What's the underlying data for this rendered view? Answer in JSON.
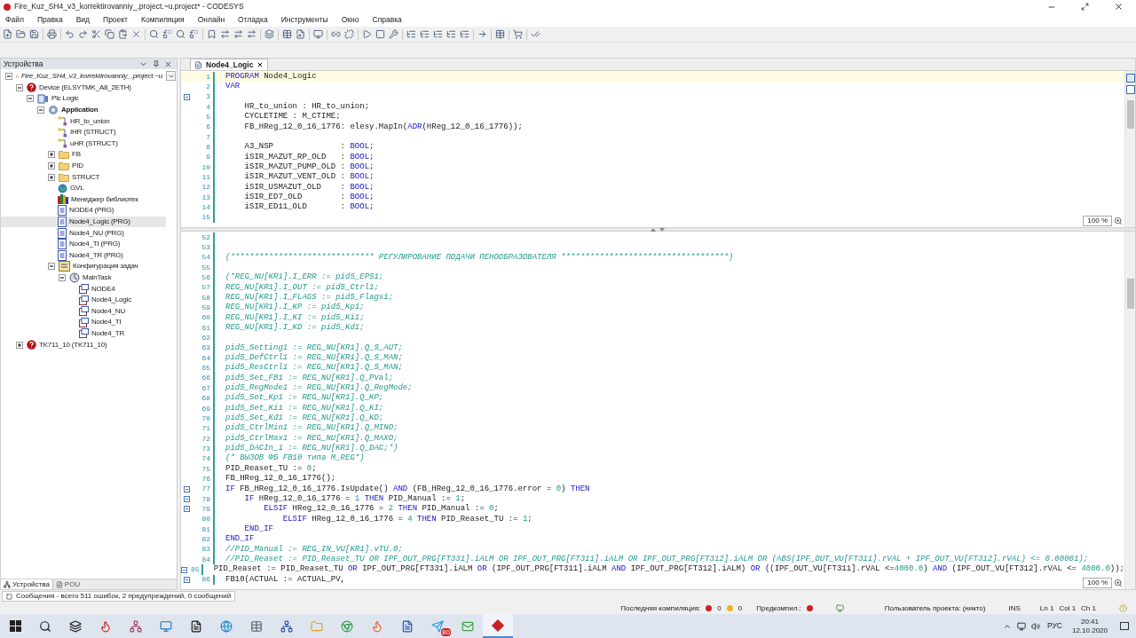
{
  "window": {
    "title": "Fire_Kuz_SH4_v3_korrektirovanniy_.project.~u.project* - CODESYS"
  },
  "menu": [
    "Файл",
    "Правка",
    "Вид",
    "Проект",
    "Компиляция",
    "Онлайн",
    "Отладка",
    "Инструменты",
    "Окно",
    "Справка"
  ],
  "devices_panel": {
    "title": "Устройства",
    "tree": [
      {
        "label": "Fire_Kuz_SH4_v3_korrektirovanniy_.project.~u",
        "kind": "project",
        "expanded": true,
        "selected": false,
        "children": [
          {
            "label": "Device (ELSYTMK_A8_2ETH)",
            "kind": "error",
            "expanded": true,
            "selected": false,
            "children": [
              {
                "label": "Plc Logic",
                "kind": "plc",
                "expanded": true,
                "selected": false,
                "children": [
                  {
                    "label": "Application",
                    "kind": "gear",
                    "expanded": true,
                    "selected": false,
                    "children": [
                      {
                        "label": "HR_to_union",
                        "kind": "struct",
                        "selected": false
                      },
                      {
                        "label": "IHR (STRUCT)",
                        "kind": "struct",
                        "selected": false
                      },
                      {
                        "label": "uHR (STRUCT)",
                        "kind": "struct",
                        "selected": false
                      },
                      {
                        "label": "FB",
                        "kind": "folder",
                        "expanded": false,
                        "selected": false
                      },
                      {
                        "label": "PID",
                        "kind": "folder",
                        "expanded": false,
                        "selected": false
                      },
                      {
                        "label": "STRUCT",
                        "kind": "folder",
                        "expanded": false,
                        "selected": false
                      },
                      {
                        "label": "GVL",
                        "kind": "globe",
                        "selected": false
                      },
                      {
                        "label": "Менеджер библиотек",
                        "kind": "library",
                        "selected": false
                      },
                      {
                        "label": "NODE4 (PRG)",
                        "kind": "prg",
                        "selected": false
                      },
                      {
                        "label": "Node4_Logic (PRG)",
                        "kind": "prg",
                        "selected": true
                      },
                      {
                        "label": "Node4_NU (PRG)",
                        "kind": "prg",
                        "selected": false
                      },
                      {
                        "label": "Node4_TI (PRG)",
                        "kind": "prg",
                        "selected": false
                      },
                      {
                        "label": "Node4_TR (PRG)",
                        "kind": "prg",
                        "selected": false
                      },
                      {
                        "label": "Конфигурация задач",
                        "kind": "taskconfig",
                        "expanded": true,
                        "selected": false,
                        "children": [
                          {
                            "label": "MainTask",
                            "kind": "task",
                            "expanded": true,
                            "selected": false,
                            "children": [
                              {
                                "label": "NODE4",
                                "kind": "call",
                                "selected": false
                              },
                              {
                                "label": "Node4_Logic",
                                "kind": "call",
                                "selected": false
                              },
                              {
                                "label": "Node4_NU",
                                "kind": "call",
                                "selected": false
                              },
                              {
                                "label": "Node4_TI",
                                "kind": "call",
                                "selected": false
                              },
                              {
                                "label": "Node4_TR",
                                "kind": "call",
                                "selected": false
                              }
                            ]
                          }
                        ]
                      }
                    ]
                  }
                ]
              }
            ]
          },
          {
            "label": "TK711_10 (TK711_10)",
            "kind": "error",
            "expanded": false,
            "selected": false
          }
        ]
      }
    ]
  },
  "bottom_tabs": [
    {
      "label": "Устройства",
      "selected": true
    },
    {
      "label": "POU",
      "selected": false
    }
  ],
  "editor": {
    "tab": "Node4_Logic",
    "top_pane": {
      "zoom": "100 %",
      "lines": [
        {
          "num": "1",
          "fold": false,
          "current": true,
          "tokens": [
            {
              "kind": "kw",
              "text": "PROGRAM"
            },
            {
              "kind": "plain",
              "text": " Node4_Logic"
            }
          ]
        },
        {
          "num": "2",
          "fold": false,
          "current": false,
          "tokens": [
            {
              "kind": "kw",
              "text": "VAR"
            }
          ]
        },
        {
          "num": "3",
          "fold": true,
          "current": false
        },
        {
          "num": "4",
          "fold": false,
          "current": false,
          "tokens": [
            {
              "kind": "plain",
              "text": "    HR_to_union : HR_to_union;"
            }
          ]
        },
        {
          "num": "5",
          "fold": false,
          "current": false,
          "tokens": [
            {
              "kind": "plain",
              "text": "    CYCLETIME : M_CTIME;"
            }
          ]
        },
        {
          "num": "6",
          "fold": false,
          "current": false,
          "tokens": [
            {
              "kind": "plain",
              "text": "    FB_HReg_12_0_16_1776: elesy.MapIn("
            },
            {
              "kind": "kw",
              "text": "ADR"
            },
            {
              "kind": "plain",
              "text": "(HReg_12_0_16_1776));"
            }
          ]
        },
        {
          "num": "7",
          "fold": false,
          "current": false
        },
        {
          "num": "8",
          "fold": false,
          "current": false,
          "tokens": [
            {
              "kind": "plain",
              "text": "    A3_NSP              : "
            },
            {
              "kind": "kw",
              "text": "BOOL"
            },
            {
              "kind": "plain",
              "text": ";"
            }
          ]
        },
        {
          "num": "9",
          "fold": false,
          "current": false,
          "tokens": [
            {
              "kind": "plain",
              "text": "    iSIR_MAZUT_RP_OLD   : "
            },
            {
              "kind": "kw",
              "text": "BOOL"
            },
            {
              "kind": "plain",
              "text": ";"
            }
          ]
        },
        {
          "num": "10",
          "fold": false,
          "current": false,
          "tokens": [
            {
              "kind": "plain",
              "text": "    iSIR_MAZUT_PUMP_OLD : "
            },
            {
              "kind": "kw",
              "text": "BOOL"
            },
            {
              "kind": "plain",
              "text": ";"
            }
          ]
        },
        {
          "num": "11",
          "fold": false,
          "current": false,
          "tokens": [
            {
              "kind": "plain",
              "text": "    iSIR_MAZUT_VENT_OLD : "
            },
            {
              "kind": "kw",
              "text": "BOOL"
            },
            {
              "kind": "plain",
              "text": ";"
            }
          ]
        },
        {
          "num": "12",
          "fold": false,
          "current": false,
          "tokens": [
            {
              "kind": "plain",
              "text": "    iSIR_USMAZUT_OLD    : "
            },
            {
              "kind": "kw",
              "text": "BOOL"
            },
            {
              "kind": "plain",
              "text": ";"
            }
          ]
        },
        {
          "num": "13",
          "fold": false,
          "current": false,
          "tokens": [
            {
              "kind": "plain",
              "text": "    iSIR_ED7_OLD        : "
            },
            {
              "kind": "kw",
              "text": "BOOL"
            },
            {
              "kind": "plain",
              "text": ";"
            }
          ]
        },
        {
          "num": "14",
          "fold": false,
          "current": false,
          "tokens": [
            {
              "kind": "plain",
              "text": "    iSIR_ED11_OLD       : "
            },
            {
              "kind": "kw",
              "text": "BOOL"
            },
            {
              "kind": "plain",
              "text": ";"
            }
          ]
        },
        {
          "num": "15",
          "fold": false,
          "current": false
        }
      ]
    },
    "bottom_pane": {
      "zoom": "100 %",
      "lines": [
        {
          "num": "52",
          "fold": false
        },
        {
          "num": "53",
          "fold": false
        },
        {
          "num": "54",
          "fold": false,
          "tokens": [
            {
              "kind": "comment",
              "text": "(****************************** РЕГУЛИРОВАНИЕ ПОДАЧИ ПЕНООБРАЗОВАТЕЛЯ ***********************************)"
            }
          ]
        },
        {
          "num": "55",
          "fold": false
        },
        {
          "num": "56",
          "fold": false,
          "tokens": [
            {
              "kind": "comment",
              "text": "(*REG_NU[KR1].I_ERR := pid5_EPS1;"
            }
          ]
        },
        {
          "num": "57",
          "fold": false,
          "tokens": [
            {
              "kind": "comment",
              "text": "REG_NU[KR1].I_OUT := pid5_Ctrl1;"
            }
          ]
        },
        {
          "num": "58",
          "fold": false,
          "tokens": [
            {
              "kind": "comment",
              "text": "REG_NU[KR1].I_FLAGS := pid5_Flags1;"
            }
          ]
        },
        {
          "num": "59",
          "fold": false,
          "tokens": [
            {
              "kind": "comment",
              "text": "REG_NU[KR1].I_KP := pid5_Kp1;"
            }
          ]
        },
        {
          "num": "60",
          "fold": false,
          "tokens": [
            {
              "kind": "comment",
              "text": "REG_NU[KR1].I_KI := pid5_Ki1;"
            }
          ]
        },
        {
          "num": "61",
          "fold": false,
          "tokens": [
            {
              "kind": "comment",
              "text": "REG_NU[KR1].I_KD := pid5_Kd1;"
            }
          ]
        },
        {
          "num": "62",
          "fold": false
        },
        {
          "num": "63",
          "fold": false,
          "tokens": [
            {
              "kind": "comment",
              "text": "pid5_Setting1 := REG_NU[KR1].Q_S_AUT;"
            }
          ]
        },
        {
          "num": "64",
          "fold": false,
          "tokens": [
            {
              "kind": "comment",
              "text": "pid5_DefCtrl1 := REG_NU[KR1].Q_S_MAN;"
            }
          ]
        },
        {
          "num": "65",
          "fold": false,
          "tokens": [
            {
              "kind": "comment",
              "text": "pid5_ResCtrl1 := REG_NU[KR1].Q_S_MAN;"
            }
          ]
        },
        {
          "num": "66",
          "fold": false,
          "tokens": [
            {
              "kind": "comment",
              "text": "pid5_Set_FB1 := REG_NU[KR1].Q_PVal;"
            }
          ]
        },
        {
          "num": "67",
          "fold": false,
          "tokens": [
            {
              "kind": "comment",
              "text": "pid5_RegMode1 := REG_NU[KR1].Q_RegMode;"
            }
          ]
        },
        {
          "num": "68",
          "fold": false,
          "tokens": [
            {
              "kind": "comment",
              "text": "pid5_Set_Kp1 := REG_NU[KR1].Q_KP;"
            }
          ]
        },
        {
          "num": "69",
          "fold": false,
          "tokens": [
            {
              "kind": "comment",
              "text": "pid5_Set_Ki1 := REG_NU[KR1].Q_KI;"
            }
          ]
        },
        {
          "num": "70",
          "fold": false,
          "tokens": [
            {
              "kind": "comment",
              "text": "pid5_Set_Kd1 := REG_NU[KR1].Q_KD;"
            }
          ]
        },
        {
          "num": "71",
          "fold": false,
          "tokens": [
            {
              "kind": "comment",
              "text": "pid5_CtrlMin1 := REG_NU[KR1].Q_MINO;"
            }
          ]
        },
        {
          "num": "72",
          "fold": false,
          "tokens": [
            {
              "kind": "comment",
              "text": "pid5_CtrlMax1 := REG_NU[KR1].Q_MAXO;"
            }
          ]
        },
        {
          "num": "73",
          "fold": false,
          "tokens": [
            {
              "kind": "comment",
              "text": "pid5_DACIn_1 := REG_NU[KR1].Q_DAC;*)"
            }
          ]
        },
        {
          "num": "74",
          "fold": false,
          "tokens": [
            {
              "kind": "comment",
              "text": "(* ВЫЗОВ ФБ FB10 типа M_REG*)"
            }
          ]
        },
        {
          "num": "75",
          "fold": false,
          "tokens": [
            {
              "kind": "plain",
              "text": "PID_Reaset_TU := "
            },
            {
              "kind": "num",
              "text": "0"
            },
            {
              "kind": "plain",
              "text": ";"
            }
          ]
        },
        {
          "num": "76",
          "fold": false,
          "tokens": [
            {
              "kind": "plain",
              "text": "FB_HReg_12_0_16_1776();"
            }
          ]
        },
        {
          "num": "77",
          "fold": true,
          "tokens": [
            {
              "kind": "kw",
              "text": "IF"
            },
            {
              "kind": "plain",
              "text": " FB_HReg_12_0_16_1776.IsUpdate() "
            },
            {
              "kind": "kw",
              "text": "AND"
            },
            {
              "kind": "plain",
              "text": " (FB_HReg_12_0_16_1776.error = "
            },
            {
              "kind": "num",
              "text": "0"
            },
            {
              "kind": "plain",
              "text": ") "
            },
            {
              "kind": "kw",
              "text": "THEN"
            }
          ]
        },
        {
          "num": "78",
          "fold": true,
          "tokens": [
            {
              "kind": "kw",
              "text": "    IF"
            },
            {
              "kind": "plain",
              "text": " HReg_12_0_16_1776 = "
            },
            {
              "kind": "num",
              "text": "1"
            },
            {
              "kind": "kw",
              "text": " THEN"
            },
            {
              "kind": "plain",
              "text": " PID_Manual := "
            },
            {
              "kind": "num",
              "text": "1"
            },
            {
              "kind": "plain",
              "text": ";"
            }
          ]
        },
        {
          "num": "79",
          "fold": true,
          "tokens": [
            {
              "kind": "kw",
              "text": "        ELSIF"
            },
            {
              "kind": "plain",
              "text": " HReg_12_0_16_1776 = "
            },
            {
              "kind": "num",
              "text": "2"
            },
            {
              "kind": "kw",
              "text": " THEN"
            },
            {
              "kind": "plain",
              "text": " PID_Manual := "
            },
            {
              "kind": "num",
              "text": "0"
            },
            {
              "kind": "plain",
              "text": ";"
            }
          ]
        },
        {
          "num": "80",
          "fold": false,
          "tokens": [
            {
              "kind": "kw",
              "text": "            ELSIF"
            },
            {
              "kind": "plain",
              "text": " HReg_12_0_16_1776 = "
            },
            {
              "kind": "num",
              "text": "4"
            },
            {
              "kind": "kw",
              "text": " THEN"
            },
            {
              "kind": "plain",
              "text": " PID_Reaset_TU := "
            },
            {
              "kind": "num",
              "text": "1"
            },
            {
              "kind": "plain",
              "text": ";"
            }
          ]
        },
        {
          "num": "81",
          "fold": false,
          "tokens": [
            {
              "kind": "kw",
              "text": "    END_IF"
            }
          ]
        },
        {
          "num": "82",
          "fold": false,
          "tokens": [
            {
              "kind": "kw",
              "text": "END_IF"
            }
          ]
        },
        {
          "num": "83",
          "fold": false,
          "tokens": [
            {
              "kind": "comment",
              "text": "//PID_Manual := REG_IN_VU[KR1].vTU.0;"
            }
          ]
        },
        {
          "num": "84",
          "fold": false,
          "tokens": [
            {
              "kind": "comment",
              "text": "//PID_Reaset := PID_Reaset_TU OR IPF_OUT_PRG[FT331].iALM OR IPF_OUT_PRG[FT311].iALM OR IPF_OUT_PRG[FT312].iALM OR (ABS(IPF_OUT_VU[FT311].rVAL + IPF_OUT_VU[FT312].rVAL) <= 0.00001);"
            }
          ]
        },
        {
          "num": "85",
          "fold": true,
          "tokens": [
            {
              "kind": "plain",
              "text": "PID_Reaset := PID_Reaset_TU "
            },
            {
              "kind": "kw",
              "text": "OR"
            },
            {
              "kind": "plain",
              "text": " IPF_OUT_PRG[FT331].iALM "
            },
            {
              "kind": "kw",
              "text": "OR"
            },
            {
              "kind": "plain",
              "text": " (IPF_OUT_PRG[FT311].iALM "
            },
            {
              "kind": "kw",
              "text": "AND"
            },
            {
              "kind": "plain",
              "text": " IPF_OUT_PRG[FT312].iALM) "
            },
            {
              "kind": "kw",
              "text": "OR"
            },
            {
              "kind": "plain",
              "text": " ((IPF_OUT_VU[FT311].rVAL <="
            },
            {
              "kind": "num",
              "text": "4000.0"
            },
            {
              "kind": "plain",
              "text": ") "
            },
            {
              "kind": "kw",
              "text": "AND"
            },
            {
              "kind": "plain",
              "text": " (IPF_OUT_VU[FT312].rVAL <= "
            },
            {
              "kind": "num",
              "text": "4000.0"
            },
            {
              "kind": "plain",
              "text": "));"
            }
          ]
        },
        {
          "num": "86",
          "fold": true,
          "tokens": [
            {
              "kind": "plain",
              "text": "FB10(ACTUAL := ACTUAL_PV,"
            }
          ]
        }
      ]
    }
  },
  "messages": "Сообщения - всего 511 ошибок, 2 предупреждений, 0 сообщений",
  "status_bar": {
    "last_build_label": "Последняя компиляция:",
    "errors": "0",
    "warnings": "0",
    "precompile_label": "Предкомпил.:",
    "user": "Пользователь проекта: (никто)",
    "mode": "INS",
    "line": "Ln 1",
    "col": "Col 1",
    "ch": "Ch 1"
  },
  "taskbar": {
    "chat_badge": "80",
    "language": "РУС",
    "time": "20:41",
    "date": "12.10.2020"
  }
}
